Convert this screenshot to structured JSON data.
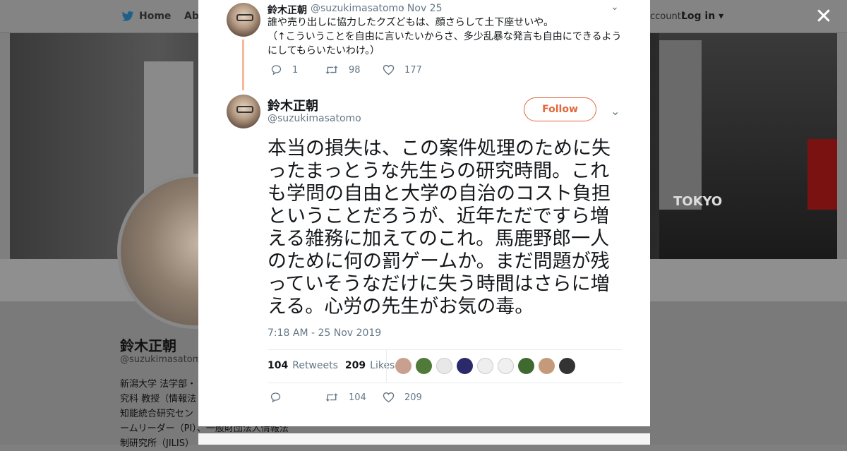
{
  "background": {
    "nav": {
      "home": "Home",
      "about": "Abo",
      "account_prompt": "ccount?",
      "login": "Log in"
    },
    "banner_text": "TOKYO",
    "profile": {
      "name": "鈴木正朝",
      "handle": "@suzukimasatom",
      "bio_lines": [
        "新潟大学 法学部・",
        "究科 教授（情報法",
        "知能統合研究セン",
        "ームリーダー（PI）、一般財団法人情報法",
        "制研究所（JILIS）"
      ]
    }
  },
  "modal": {
    "parent_tweet": {
      "name": "鈴木正朝",
      "handle": "@suzukimasatomo",
      "time": "· Nov 25",
      "text": "誰や売り出しに協力したクズどもは、顔さらして土下座せいや。\n（↑こういうことを自由に言いたいからさ、多少乱暴な発言も自由にできるようにしてもらいたいわけ。）",
      "replies": "1",
      "retweets": "98",
      "likes": "177"
    },
    "main_tweet": {
      "name": "鈴木正朝",
      "handle": "@suzukimasatomo",
      "follow_label": "Follow",
      "text": "本当の損失は、この案件処理のために失ったまっとうな先生らの研究時間。これも学問の自由と大学の自治のコスト負担ということだろうが、近年ただですら増える雑務に加えてのこれ。馬鹿野郎一人のために何の罰ゲームか。まだ問題が残っていそうなだけに失う時間はさらに増える。心労の先生がお気の毒。",
      "timestamp": "7:18 AM - 25 Nov 2019",
      "retweets_count": "104",
      "retweets_label": "Retweets",
      "likes_count": "209",
      "likes_label": "Likes",
      "retweet_action": "104",
      "like_action": "209"
    },
    "liker_colors": [
      "#c9a08f",
      "#4f7a3a",
      "#e8e8e8",
      "#2a2a6a",
      "#eeeeee",
      "#f0f0f0",
      "#3e6a2f",
      "#c59a7a",
      "#333333"
    ]
  },
  "colors": {
    "accent": "#e0683c",
    "thread": "#f5b99c",
    "muted": "#657786",
    "text": "#14171a"
  }
}
